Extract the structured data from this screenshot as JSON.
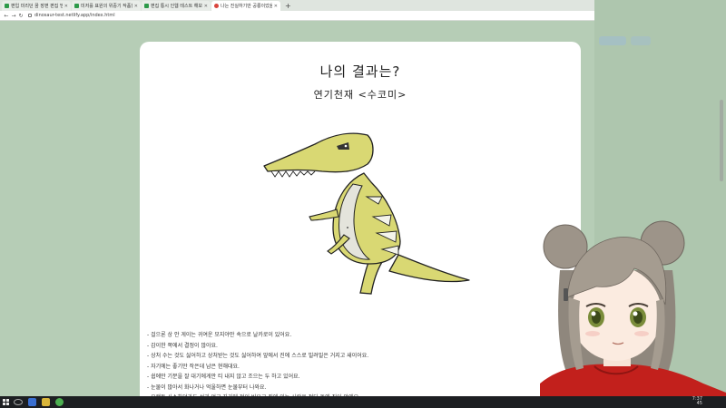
{
  "browser": {
    "tabs": [
      {
        "title": "편입 미리던 꿈 장편 편집 방송",
        "favicon": "sheet-icon"
      },
      {
        "title": "미저를 표원의 위중기 작품한",
        "favicon": "sheet-icon"
      },
      {
        "title": "편집 통시 인웹 테스트 해보리",
        "favicon": "sheet-icon"
      },
      {
        "title": "나는 진실하기만 공룡이었을까",
        "favicon": "dino-icon"
      }
    ],
    "url": "dinosaur-test.netlify.app/index.html"
  },
  "result": {
    "title": "나의 결과는?",
    "subtitle": "연기천재 <수코미>",
    "descriptions": [
      "- 걸으론 상 안 게이는 귀여운 모지야만 속으로 날카로이 있어요.",
      "- 감이한 쪽에서 결정이 많아요.",
      "- 상처 수는 것도 싫어하고 상처받는 것도 싫어하여 앞에서 진에 스스로 빌려밀은 거지고 새이어요.",
      "- 자기에는 좋기만 작은데 남은 현해대요.",
      "- 쉽에만 기분을 잘 대기에게만 티 내지 않고 조으는 두 하고 있어요.",
      "- 눈물이 많아서 화나거나 억울하면 눈물부터 나와요.",
      "- 오랫동 사소하더라도 성과 없고 자기에 전이 비우고 집에 있는 사람은 적다 돌에 짐어 앞에요."
    ]
  },
  "taskbar": {
    "time": "7:37",
    "date": "45"
  },
  "colors": {
    "background": "#b6cdb6",
    "dino_body": "#d9d873",
    "dino_belly": "#e4e4dc"
  }
}
